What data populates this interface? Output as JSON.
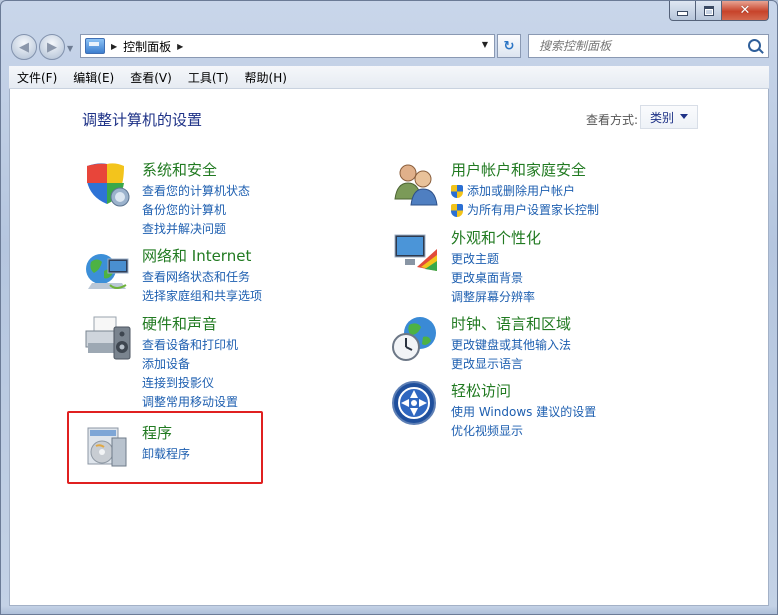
{
  "window": {
    "minimize_glyph": "",
    "maximize_glyph": "",
    "close_glyph": "✕"
  },
  "nav": {
    "back_glyph": "◀",
    "forward_glyph": "▶",
    "address": "控制面板",
    "search_placeholder": "搜索控制面板"
  },
  "menu": [
    "文件(F)",
    "编辑(E)",
    "查看(V)",
    "工具(T)",
    "帮助(H)"
  ],
  "page": {
    "title": "调整计算机的设置",
    "view_by_label": "查看方式:",
    "view_by_value": "类别"
  },
  "categories": [
    {
      "icon": "shield-icon",
      "title": "系统和安全",
      "links": [
        "查看您的计算机状态",
        "备份您的计算机",
        "查找并解决问题"
      ]
    },
    {
      "icon": "network-icon",
      "title": "网络和 Internet",
      "links": [
        "查看网络状态和任务",
        "选择家庭组和共享选项"
      ]
    },
    {
      "icon": "printer-icon",
      "title": "硬件和声音",
      "links": [
        "查看设备和打印机",
        "添加设备",
        "连接到投影仪",
        "调整常用移动设置"
      ]
    },
    {
      "icon": "programs-icon",
      "title": "程序",
      "links": [
        "卸载程序"
      ]
    },
    {
      "icon": "users-icon",
      "title": "用户帐户和家庭安全",
      "links": [
        "添加或删除用户帐户",
        "为所有用户设置家长控制"
      ]
    },
    {
      "icon": "appearance-icon",
      "title": "外观和个性化",
      "links": [
        "更改主题",
        "更改桌面背景",
        "调整屏幕分辨率"
      ]
    },
    {
      "icon": "clock-globe-icon",
      "title": "时钟、语言和区域",
      "links": [
        "更改键盘或其他输入法",
        "更改显示语言"
      ]
    },
    {
      "icon": "ease-of-access-icon",
      "title": "轻松访问",
      "links": [
        "使用 Windows 建议的设置",
        "优化视频显示"
      ]
    }
  ]
}
